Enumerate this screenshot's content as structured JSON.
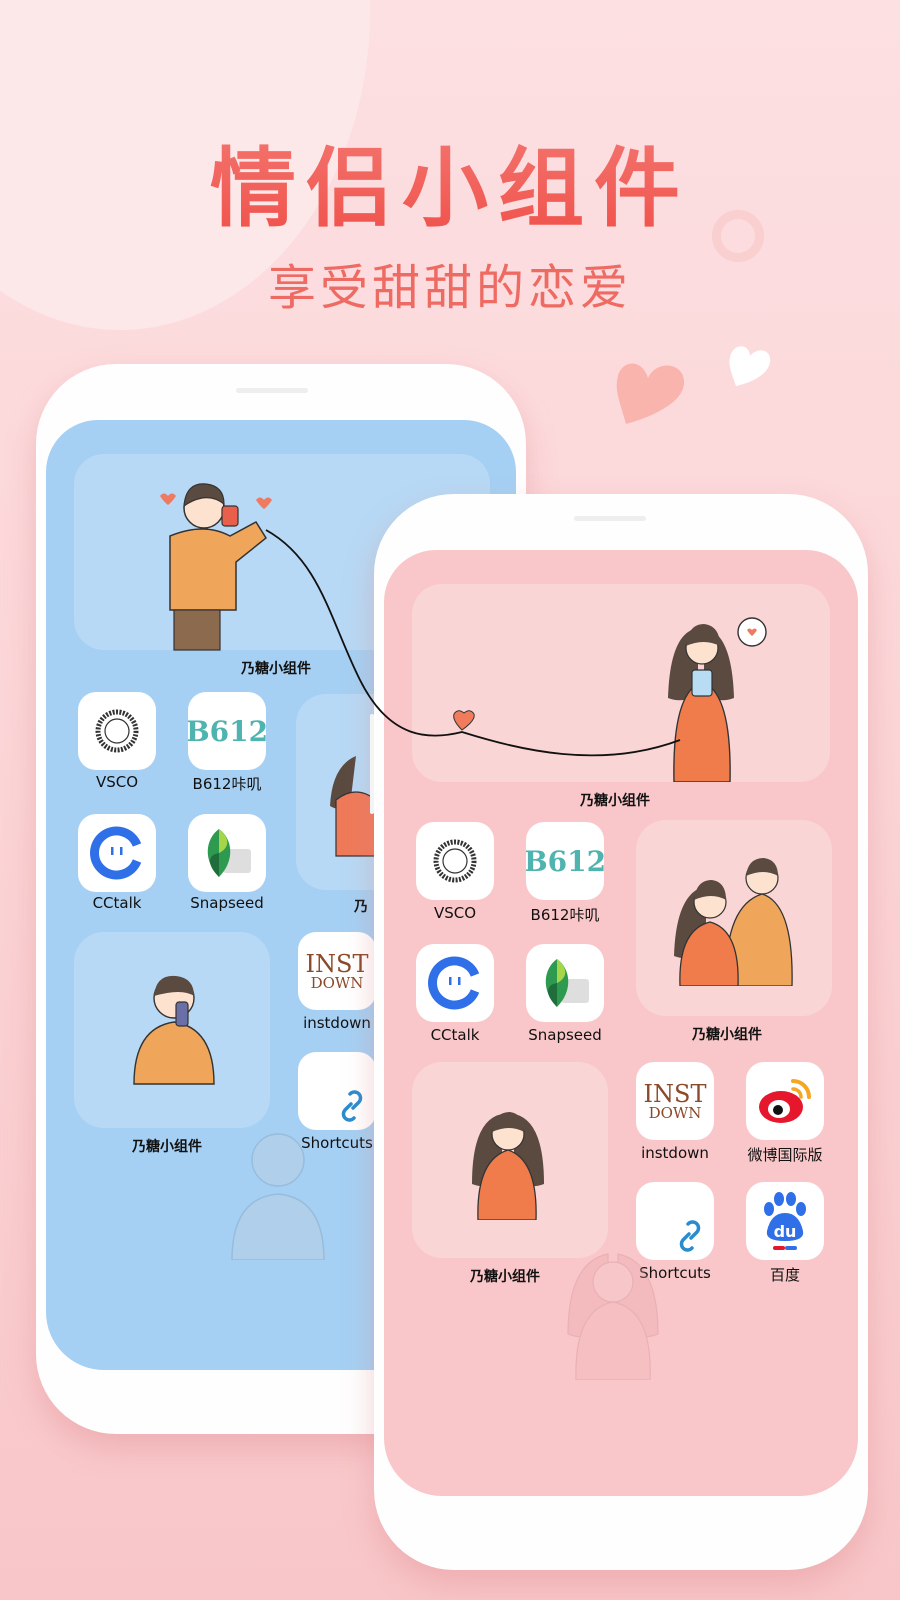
{
  "header": {
    "title": "情侣小组件",
    "subtitle": "享受甜甜的恋爱"
  },
  "colors": {
    "accent": "#f25c55",
    "left_screen": "#a5d0f3",
    "right_screen": "#f9c7c9"
  },
  "left_phone": {
    "widgets": [
      {
        "label": "乃糖小组件",
        "icon": "boy-phone-call-illustration"
      },
      {
        "label": "乃",
        "icon": "couple-hug-illustration"
      },
      {
        "label": "乃糖小组件",
        "icon": "boy-selfie-illustration"
      }
    ],
    "apps": [
      {
        "label": "VSCO",
        "icon": "vsco-icon"
      },
      {
        "label": "B612咔叽",
        "icon": "b612-icon"
      },
      {
        "label": "CCtalk",
        "icon": "cctalk-icon"
      },
      {
        "label": "Snapseed",
        "icon": "snapseed-icon"
      },
      {
        "label": "instdown",
        "icon": "instdown-icon"
      },
      {
        "label": "Shortcuts",
        "icon": "shortcuts-icon"
      }
    ]
  },
  "right_phone": {
    "widgets": [
      {
        "label": "乃糖小组件",
        "icon": "girl-phone-call-illustration"
      },
      {
        "label": "乃糖小组件",
        "icon": "couple-hug-illustration"
      },
      {
        "label": "乃糖小组件",
        "icon": "girl-wave-illustration"
      }
    ],
    "apps": [
      {
        "label": "VSCO",
        "icon": "vsco-icon"
      },
      {
        "label": "B612咔叽",
        "icon": "b612-icon"
      },
      {
        "label": "CCtalk",
        "icon": "cctalk-icon"
      },
      {
        "label": "Snapseed",
        "icon": "snapseed-icon"
      },
      {
        "label": "instdown",
        "icon": "instdown-icon"
      },
      {
        "label": "微博国际版",
        "icon": "weibo-icon"
      },
      {
        "label": "Shortcuts",
        "icon": "shortcuts-icon"
      },
      {
        "label": "百度",
        "icon": "baidu-icon"
      }
    ]
  },
  "icon_text": {
    "b612": "B612",
    "inst_top": "INST",
    "inst_bottom": "DOWN",
    "baidu": "du"
  }
}
